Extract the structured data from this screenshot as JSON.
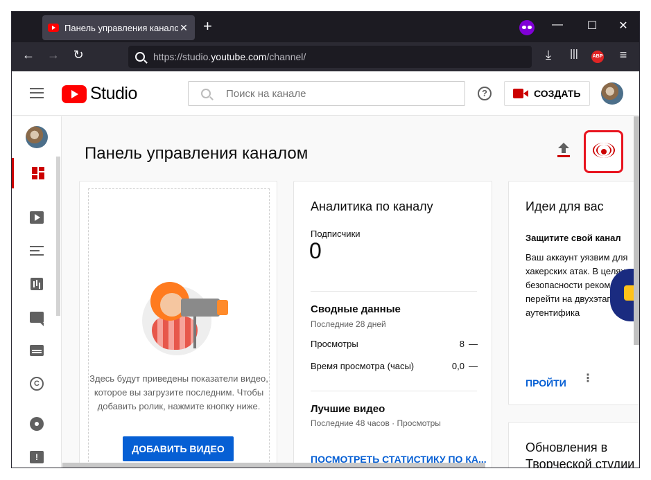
{
  "browser": {
    "tab_title": "Панель управления каналом",
    "tab_close": "✕",
    "new_tab": "+",
    "url_prefix": "https://studio.",
    "url_host": "youtube.com",
    "url_suffix": "/channel/",
    "abp_label": "ABP",
    "window_controls": [
      "—",
      "☐",
      "✕"
    ]
  },
  "header": {
    "logo_text": "Studio",
    "search_placeholder": "Поиск на канале",
    "help_label": "?",
    "create_label": "СОЗДАТЬ"
  },
  "sidebar": {
    "items": [
      {
        "icon": "dashboard-icon",
        "active": true
      },
      {
        "icon": "content-icon"
      },
      {
        "icon": "playlists-icon"
      },
      {
        "icon": "analytics-icon"
      },
      {
        "icon": "comments-icon"
      },
      {
        "icon": "subtitles-icon"
      },
      {
        "icon": "copyright-icon"
      },
      {
        "icon": "settings-icon"
      },
      {
        "icon": "feedback-icon"
      }
    ],
    "copyright_glyph": "C",
    "feedback_glyph": "!"
  },
  "main": {
    "page_title": "Панель управления каналом",
    "upload_card": {
      "text": "Здесь будут приведены показатели видео, которое вы загрузите последним. Чтобы добавить ролик, нажмите кнопку ниже.",
      "button": "ДОБАВИТЬ ВИДЕО"
    },
    "analytics_card": {
      "title": "Аналитика по каналу",
      "subscribers_label": "Подписчики",
      "subscribers_value": "0",
      "summary_title": "Сводные данные",
      "summary_period": "Последние 28 дней",
      "rows": [
        {
          "label": "Просмотры",
          "value": "8",
          "trend": "—"
        },
        {
          "label": "Время просмотра (часы)",
          "value": "0,0",
          "trend": "—"
        }
      ],
      "top_title": "Лучшие видео",
      "top_period": "Последние 48 часов · Просмотры",
      "link": "ПОСМОТРЕТЬ СТАТИСТИКУ ПО КА..."
    },
    "ideas_card": {
      "title": "Идеи для вас",
      "subtitle": "Защитите свой канал",
      "text": "Ваш аккаунт уязвим для хакерских атак. В целях безопасности рекомендуем перейти на двухэтапную аутентифика",
      "link": "ПРОЙТИ",
      "more": "⋮"
    },
    "updates_card": {
      "title": "Обновления в Творческой студии"
    }
  },
  "colors": {
    "accent_red": "#cc0000",
    "highlight_red": "#e8141f",
    "link_blue": "#065fd4",
    "browser_dark": "#1c1b22"
  }
}
